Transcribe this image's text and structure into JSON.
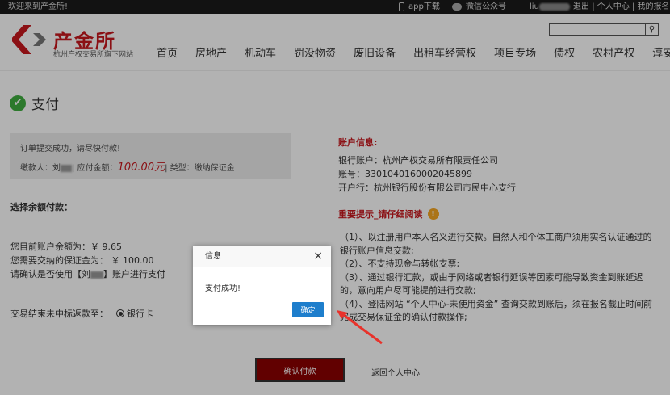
{
  "topbar": {
    "welcome": "欢迎来到产金所!",
    "app_download": "app下载",
    "wechat": "微信公众号",
    "username": "liu",
    "logout": "退出",
    "separator": "|",
    "personal_center": "个人中心",
    "my_signups": "我的报名"
  },
  "header": {
    "logo_text": "产金所",
    "logo_sub": "杭州产权交易所旗下网站",
    "nav": [
      "首页",
      "房地产",
      "机动车",
      "罚没物资",
      "废旧设备",
      "出租车经营权",
      "项目专场",
      "债权",
      "农村产权",
      "淳安产权"
    ]
  },
  "page": {
    "title": "支付",
    "notice_line1": "订单提交成功，请尽快付款!",
    "payer_label": "缴款人：刘",
    "amount_label": "| 应付金额：",
    "amount": "100.00元",
    "type_label": "| 类型：缴纳保证金",
    "select_balance": "选择余额付款：",
    "balance_line": "您目前账户余额为：￥ 9.65",
    "deposit_line": "您需要交纳的保证金为：   ￥ 100.00",
    "confirm_prefix": "请确认是否使用【刘",
    "confirm_suffix": "】账户进行支付",
    "refund_label": "交易结束未中标返款至：",
    "refund_option": "银行卡",
    "account_title": "账户信息:",
    "bank_account": "银行账户：杭州产权交易所有限责任公司",
    "account_no": "账号：3301040160002045899",
    "bank_branch": "开户行：杭州银行股份有限公司市民中心支行",
    "important_title": "重要提示_请仔细阅读",
    "tips": [
      "（1）、以注册用户本人名义进行交款。自然人和个体工商户须用实名认证通过的银行账户信息交款;",
      "（2）、不支持现金与转帐支票;",
      "（3）、通过银行汇款，或由于网络或者银行延误等因素可能导致资金到账延迟的，意向用户尽可能提前进行交款;",
      "（4）、登陆网站 “个人中心-未使用资金” 查询交款到账后，须在报名截止时间前完成交易保证金的确认付款操作;"
    ],
    "confirm_pay_button": "确认付款",
    "back_link": "返回个人中心"
  },
  "dialog": {
    "title": "信息",
    "close": "×",
    "message": "支付成功!",
    "ok_button": "确定"
  },
  "colors": {
    "brand_red": "#c8181e",
    "dialog_button": "#1e7ecc",
    "confirm_button": "#8b0000",
    "success_green": "#3fae3f"
  },
  "icons": [
    "phone-icon",
    "wechat-icon",
    "search-icon",
    "success-check-icon",
    "warning-icon",
    "close-icon",
    "red-arrow-annotation"
  ]
}
